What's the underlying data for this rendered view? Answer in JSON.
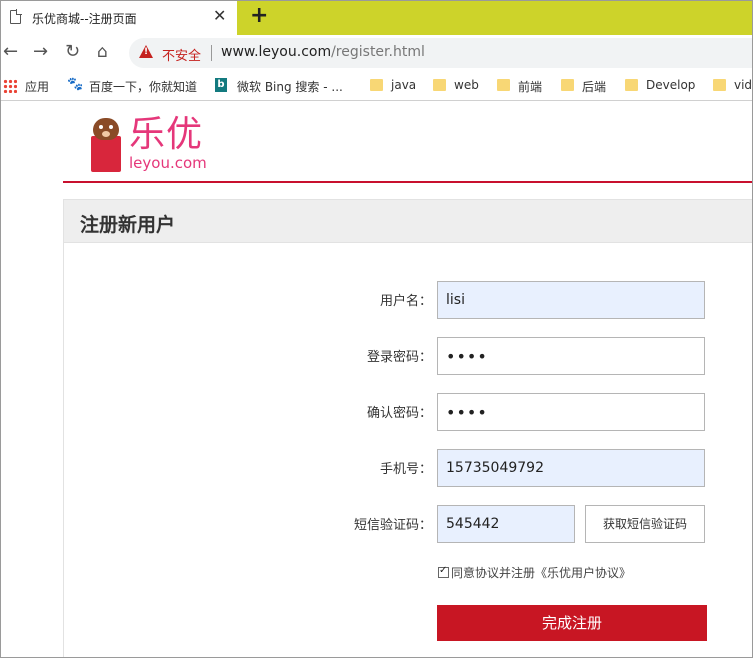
{
  "browser": {
    "tab_title": "乐优商城--注册页面",
    "tab_close": "✕",
    "new_tab": "+",
    "security_label": "不安全",
    "url_host": "www.leyou.com",
    "url_path": "/register.html"
  },
  "bookmarks": [
    {
      "label": "应用",
      "icon": "apps-icon"
    },
    {
      "label": "百度一下，你就知道",
      "icon": "baidu-icon"
    },
    {
      "label": "微软 Bing 搜索 - ...",
      "icon": "bing-icon"
    },
    {
      "label": "java",
      "icon": "folder-icon"
    },
    {
      "label": "web",
      "icon": "folder-icon"
    },
    {
      "label": "前端",
      "icon": "folder-icon"
    },
    {
      "label": "后端",
      "icon": "folder-icon"
    },
    {
      "label": "Develop",
      "icon": "folder-icon"
    },
    {
      "label": "vid",
      "icon": "folder-icon"
    }
  ],
  "site": {
    "logo_cn": "乐优",
    "logo_en": "leyou.com",
    "brand_color": "#c8102e"
  },
  "form": {
    "title": "注册新用户",
    "username_label": "用户名：",
    "username_value": "lisi",
    "password_label": "登录密码：",
    "password_value": "••••",
    "confirm_label": "确认密码：",
    "confirm_value": "••••",
    "phone_label": "手机号：",
    "phone_value": "15735049792",
    "code_label": "短信验证码：",
    "code_value": "545442",
    "get_code_button": "获取短信验证码",
    "agree_text": "同意协议并注册《乐优用户协议》",
    "agree_checked": true,
    "submit_button": "完成注册"
  }
}
